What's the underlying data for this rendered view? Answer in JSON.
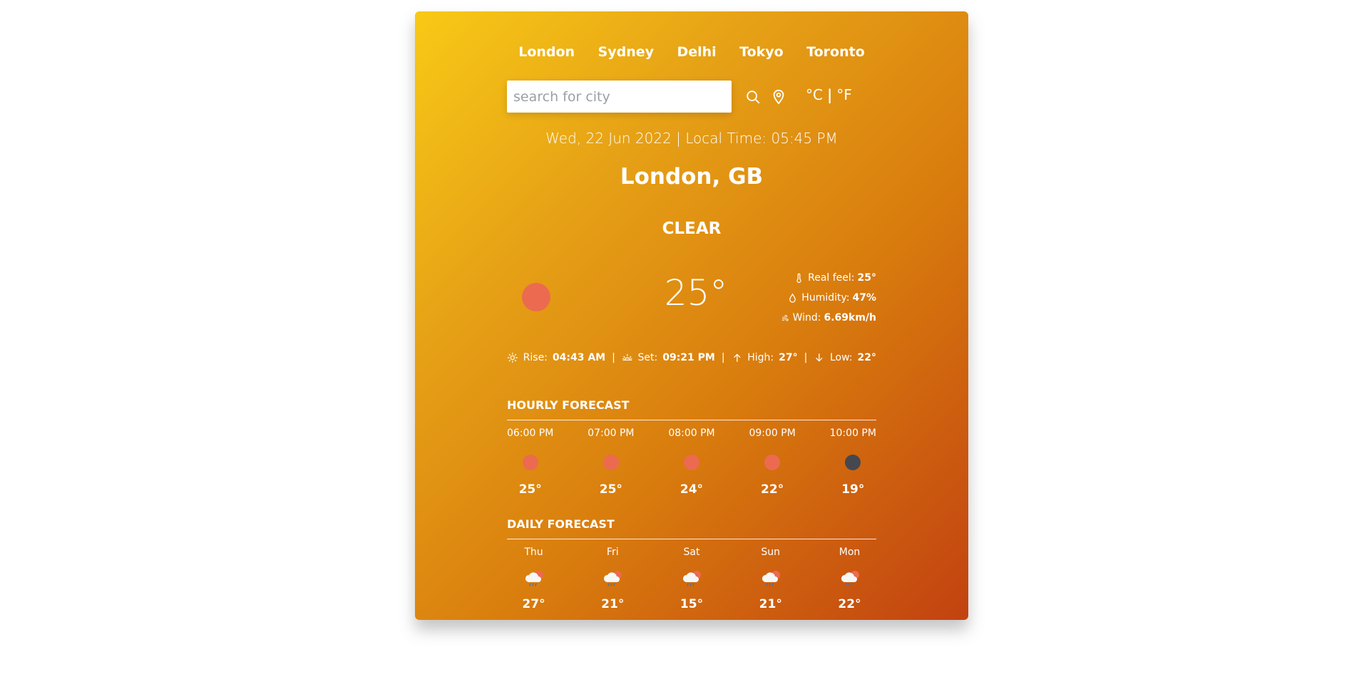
{
  "nav": {
    "cities": [
      "London",
      "Sydney",
      "Delhi",
      "Tokyo",
      "Toronto"
    ]
  },
  "search": {
    "placeholder": "search for city",
    "value": ""
  },
  "units": {
    "celsius": "°C",
    "separator": "|",
    "fahrenheit": "°F"
  },
  "header": {
    "date_time": "Wed, 22 Jun 2022 | Local Time: 05:45 PM",
    "location": "London, GB",
    "condition": "CLEAR"
  },
  "current": {
    "temperature": "25°",
    "icon_color": "#ec6a50",
    "real_feel_label": "Real feel:",
    "real_feel": "25°",
    "humidity_label": "Humidity:",
    "humidity": "47%",
    "wind_label": "Wind:",
    "wind": "6.69km/h"
  },
  "sun": {
    "rise_label": "Rise:",
    "rise": "04:43 AM",
    "set_label": "Set:",
    "set": "09:21 PM",
    "high_label": "High:",
    "high": "27°",
    "low_label": "Low:",
    "low": "22°",
    "separator": "|"
  },
  "hourly": {
    "title": "HOURLY FORECAST",
    "items": [
      {
        "time": "06:00 PM",
        "temp": "25°",
        "icon": "sun-icon",
        "color": "#ec6a50"
      },
      {
        "time": "07:00 PM",
        "temp": "25°",
        "icon": "sun-icon",
        "color": "#ec6a50"
      },
      {
        "time": "08:00 PM",
        "temp": "24°",
        "icon": "sun-icon",
        "color": "#ec6a50"
      },
      {
        "time": "09:00 PM",
        "temp": "22°",
        "icon": "sun-icon",
        "color": "#ec6a50"
      },
      {
        "time": "10:00 PM",
        "temp": "19°",
        "icon": "moon-icon",
        "color": "#45484e"
      }
    ]
  },
  "daily": {
    "title": "DAILY FORECAST",
    "items": [
      {
        "day": "Thu",
        "temp": "27°",
        "icon": "rain-cloud-icon"
      },
      {
        "day": "Fri",
        "temp": "21°",
        "icon": "rain-cloud-icon"
      },
      {
        "day": "Sat",
        "temp": "15°",
        "icon": "rain-cloud-icon"
      },
      {
        "day": "Sun",
        "temp": "21°",
        "icon": "rain-cloud-icon"
      },
      {
        "day": "Mon",
        "temp": "22°",
        "icon": "rain-cloud-icon"
      }
    ]
  }
}
